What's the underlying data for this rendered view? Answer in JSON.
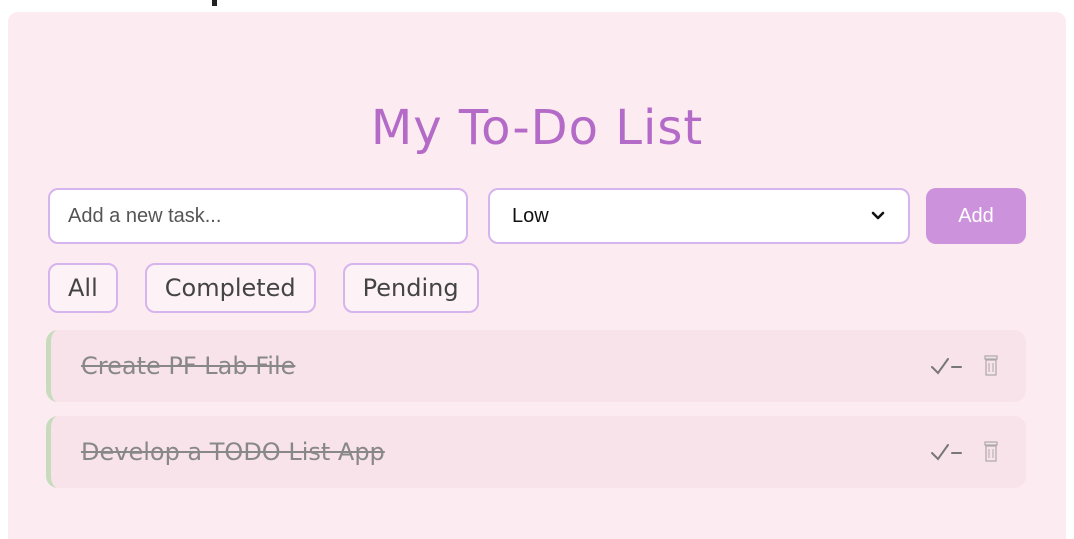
{
  "app": {
    "title": "My To-Do List"
  },
  "task_entry": {
    "placeholder": "Add a new task...",
    "priority_selected": "Low",
    "add_label": "Add"
  },
  "filters": [
    {
      "label": "All"
    },
    {
      "label": "Completed"
    },
    {
      "label": "Pending"
    }
  ],
  "tasks": [
    {
      "text": "Create PF Lab File",
      "completed": true
    },
    {
      "text": "Develop a TODO List App",
      "completed": true
    }
  ],
  "icons": {
    "complete": "check-icon",
    "delete": "trash-icon",
    "dropdown": "chevron-down-icon"
  },
  "colors": {
    "accent": "#b46bc8",
    "button": "#cc92dc",
    "border": "#d6b4ee",
    "background": "#fcebf1",
    "task_bg": "#f9e3ea",
    "done_bar": "#c7dcbd"
  }
}
